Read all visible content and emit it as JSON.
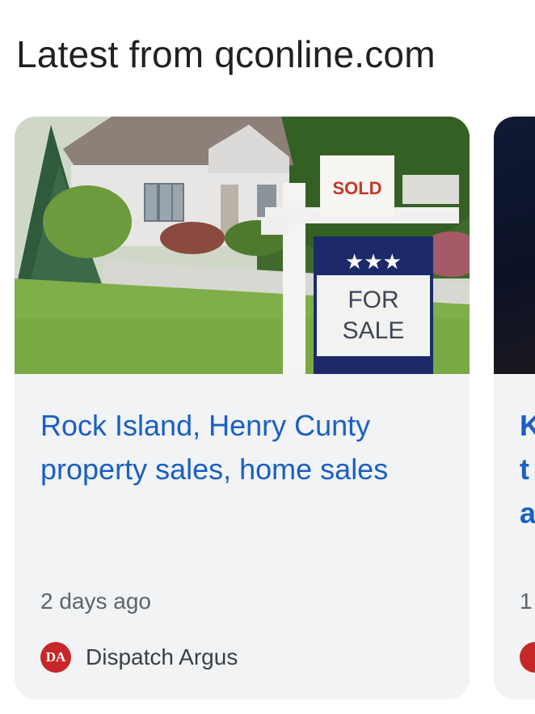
{
  "section": {
    "title": "Latest from qconline.com"
  },
  "cards": [
    {
      "image_sign_text": {
        "sold": "SOLD",
        "stars": "★★★",
        "for": "FOR",
        "sale": "SALE"
      },
      "headline": "Rock Island, Henry Cunty property sales, home sales",
      "age": "2 days ago",
      "source": {
        "name": "Dispatch Argus",
        "logo_text": "DA",
        "logo_color": "#c6282a"
      }
    },
    {
      "headline": "K\nt\na",
      "age": "1"
    }
  ],
  "colors": {
    "headline": "#1a5fc4",
    "card_background": "#f1f3f4",
    "title_text": "#202124",
    "meta_text": "#5f6368"
  }
}
